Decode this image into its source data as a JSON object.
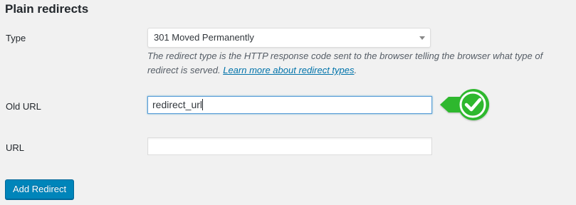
{
  "section": {
    "title": "Plain redirects"
  },
  "type_row": {
    "label": "Type",
    "selected_value": "301 Moved Permanently",
    "description_text": "The redirect type is the HTTP response code sent to the browser telling the browser what type of redirect is served.",
    "description_link": "Learn more about redirect types",
    "description_end": "."
  },
  "old_url_row": {
    "label": "Old URL",
    "value": "redirect_url"
  },
  "url_row": {
    "label": "URL",
    "value": ""
  },
  "actions": {
    "add_redirect_label": "Add Redirect"
  },
  "colors": {
    "primary_button": "#0085ba",
    "link": "#0073aa",
    "check_badge": "#2eb82e",
    "focus_border": "#5b9dd9"
  },
  "icons": {
    "select_chevron": "chevron-down-icon",
    "validation": "checkmark-icon"
  }
}
